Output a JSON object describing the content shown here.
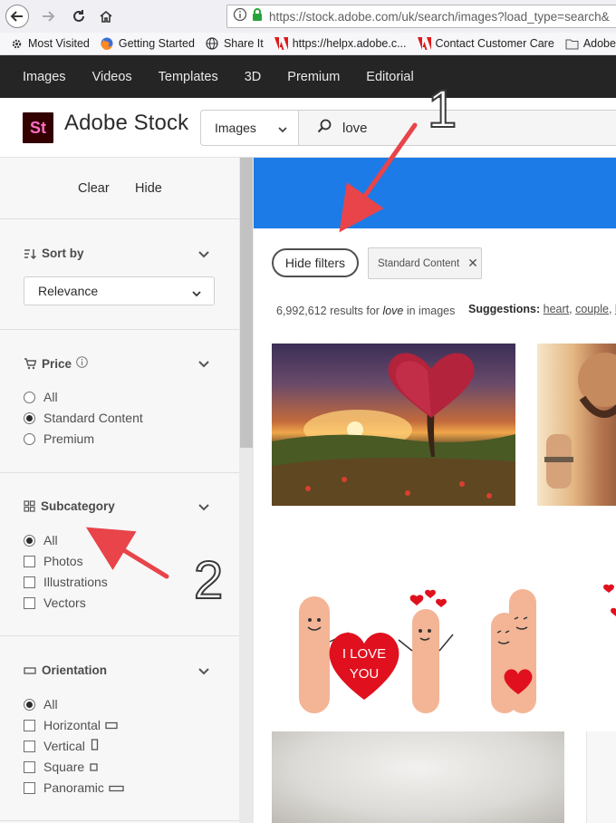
{
  "browser": {
    "url": "https://stock.adobe.com/uk/search/images?load_type=search&",
    "bookmarks": [
      {
        "label": "Most Visited",
        "icon": "gear-icon"
      },
      {
        "label": "Getting Started",
        "icon": "firefox-icon"
      },
      {
        "label": "Share It",
        "icon": "globe-icon"
      },
      {
        "label": "https://helpx.adobe.c...",
        "icon": "adobe-icon"
      },
      {
        "label": "Contact Customer Care",
        "icon": "adobe-icon"
      },
      {
        "label": "Adobe",
        "icon": "folder-icon"
      }
    ]
  },
  "site_nav": [
    "Images",
    "Videos",
    "Templates",
    "3D",
    "Premium",
    "Editorial"
  ],
  "header": {
    "logo_text": "St",
    "brand": "Adobe Stock",
    "search_type": "Images",
    "search_value": "love"
  },
  "sidebar": {
    "clear_label": "Clear",
    "hide_label": "Hide",
    "sort": {
      "title": "Sort by",
      "value": "Relevance"
    },
    "price": {
      "title": "Price",
      "options": [
        {
          "label": "All",
          "checked": false
        },
        {
          "label": "Standard Content",
          "checked": true
        },
        {
          "label": "Premium",
          "checked": false
        }
      ]
    },
    "subcategory": {
      "title": "Subcategory",
      "options": [
        {
          "label": "All",
          "checked": true
        },
        {
          "label": "Photos",
          "checked": false
        },
        {
          "label": "Illustrations",
          "checked": false
        },
        {
          "label": "Vectors",
          "checked": false
        }
      ]
    },
    "orientation": {
      "title": "Orientation",
      "options": [
        {
          "label": "All",
          "checked": true
        },
        {
          "label": "Horizontal",
          "checked": false
        },
        {
          "label": "Vertical",
          "checked": false
        },
        {
          "label": "Square",
          "checked": false
        },
        {
          "label": "Panoramic",
          "checked": false
        }
      ]
    }
  },
  "main": {
    "hide_filters_label": "Hide filters",
    "chip_label": "Standard Content",
    "results_count": "6,992,612",
    "results_mid": " results for ",
    "results_query": "love",
    "results_tail": " in images",
    "suggestions_label": "Suggestions:",
    "suggestions": [
      "heart",
      "couple",
      "l"
    ],
    "image_text": [
      "I LOVE",
      "YOU"
    ]
  },
  "annotations": {
    "one": "1",
    "two": "2"
  },
  "colors": {
    "accent_blue": "#1c7be6",
    "nav_bg": "#252525",
    "logo_bg": "#330000",
    "logo_fg": "#ff6ec7",
    "arrow_red": "#e8444a"
  }
}
